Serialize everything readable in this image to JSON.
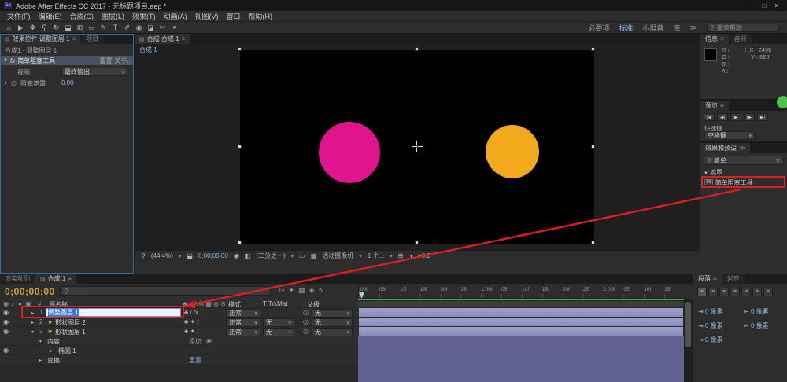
{
  "colors": {
    "annotation_red": "#dd1f1f",
    "magenta_circle": "#e0148c",
    "orange_circle": "#f2a91c",
    "layer_bar": "#9093c4",
    "expanded_region": "#616192",
    "cache_green": "#4aa845",
    "timecode_orange": "#cf9c3c",
    "value_blue": "#8cb4e4"
  },
  "title_bar": {
    "app_icon": "Ae",
    "title": "Adobe After Effects CC 2017 - 无标题项目.aep *",
    "minimize": "─",
    "maximize": "□",
    "close": "✕"
  },
  "menu_bar": [
    "文件(F)",
    "编辑(E)",
    "合成(C)",
    "图层(L)",
    "效果(T)",
    "动画(A)",
    "视图(V)",
    "窗口",
    "帮助(H)"
  ],
  "toolbar": {
    "tools": [
      "⌂",
      "▶",
      "✥",
      "⚲",
      "↻",
      "⬓",
      "⊞",
      "▭",
      "✎",
      "T",
      "✐",
      "◉",
      "◪",
      "✄",
      "⌖"
    ],
    "workspaces": [
      "必要项",
      "标准",
      "小屏幕",
      "库"
    ],
    "more_icon": "≫",
    "search_icon": "⚲",
    "search_placeholder": "搜索帮助"
  },
  "effect_controls": {
    "panel_icon": "▤",
    "tab_title": "效果控件 调整图层 1",
    "menu_icon": "≡",
    "project_tab": "项目",
    "comp_ref": "合成1 · 调整图层 1",
    "effect_expander": "▼",
    "fx_badge": "fx",
    "effect_name": "简单阻塞工具",
    "reset_label": "重置",
    "about_label": "关于..",
    "view_label": "视图",
    "view_value": "最终输出",
    "dropdown_arrow": "▾",
    "choke_expander": "▸",
    "stopwatch_icon": "◷",
    "choke_label": "阻塞遮罩",
    "choke_value": "0.00"
  },
  "viewer": {
    "panel_icon": "▤",
    "tab_title": "合成 合成 1",
    "menu_icon": "≡",
    "comp_chip": "合成 1",
    "zoom_icon": "⚲",
    "zoom_value": "(44.4%)",
    "dropdown_arrow": "▾",
    "safe_icon": "⬓",
    "timecode": "0;00;00;00",
    "snapshot_icon": "◉",
    "channel_icon": "◧",
    "resolution": "(二分之一)",
    "roi_icon": "▭",
    "grid_icon": "▦",
    "camera_value": "活动摄像机",
    "view_count": "1 个...",
    "pixel_icon": "⊞",
    "exposure_icon": "◑",
    "exposure_value": "+0.0"
  },
  "info_panel": {
    "tab": "信息",
    "menu_icon": "≡",
    "audio_tab": "音频",
    "r_label": "R :",
    "g_label": "G :",
    "b_label": "B :",
    "a_label": "A :",
    "crosshair": "⊹",
    "x_label": "X : 2495",
    "y_label": "Y : 553"
  },
  "preview_panel": {
    "tab": "预览",
    "menu_icon": "≡",
    "buttons": [
      "|◀",
      "◀|",
      "▶",
      "|▶",
      "▶|"
    ],
    "shortcut_label": "快捷键",
    "shortcut_value": "空格键",
    "dropdown_arrow": "▾"
  },
  "presets_panel": {
    "tab": "效果和预设",
    "more_icon": "≫",
    "search_icon": "⚲",
    "search_value": "简单",
    "clear_icon": "✕",
    "category_expander": "▼",
    "category": "遮罩",
    "item_badge": "16",
    "item_name": "简单阻塞工具"
  },
  "timeline": {
    "render_queue_tab": "渲染队列",
    "comp_icon": "▤",
    "comp_tab": "合成 1",
    "menu_icon": "≡",
    "timecode": "0;00;00;00",
    "search_icon": "⚲",
    "toolbar_icons": [
      "⊙",
      "✦",
      "▦",
      "◈",
      "∿"
    ],
    "eye_icon": "◉",
    "audio_icon": "♪",
    "solo_icon": "●",
    "lock_icon": "▣",
    "col_num": "#",
    "col_source": "源名称",
    "switch_icons": "♣ ✦ \\ fx ▦ ◎ ⊙",
    "col_mode": "模式",
    "col_trkmat": "T TrkMat",
    "col_parent": "父级",
    "expander_closed": "▸",
    "expander_open": "▾",
    "star_icon": "★",
    "pickwhip_icon": "◎",
    "mode_normal": "正常",
    "dropdown_arrow": "▾",
    "none_value": "无",
    "layers": [
      {
        "num": "1",
        "name": "调整图层 1",
        "switches": "♣ / fx"
      },
      {
        "num": "2",
        "name": "形状图层 2",
        "switches": "♣ ✦ /"
      },
      {
        "num": "3",
        "name": "形状图层 1",
        "switches": "♣ ✦ /"
      }
    ],
    "contents_label": "内容",
    "add_label": "添加:",
    "add_icon": "◉",
    "ellipse_label": "椭圆 1",
    "transform_label": "变换",
    "reset_label": "重置",
    "ruler": [
      ":00f",
      "05f",
      "10f",
      "15f",
      "20f",
      "25f",
      "1:00f",
      "05f",
      "10f",
      "15f",
      "20f",
      "25f",
      "2:00f",
      "05f",
      "10f",
      "15f"
    ]
  },
  "paragraph_panel": {
    "tab": "段落",
    "align_tab": "对齐",
    "menu_icon": "≡",
    "align_icons": [
      "≡",
      "≡",
      "≡",
      "≡",
      "≡",
      "≡",
      "≡"
    ],
    "fields": [
      {
        "icon": "⇥",
        "value": "0 像素"
      },
      {
        "icon": "⇤",
        "value": "0 像素"
      },
      {
        "icon": "⇥",
        "value": "0 像素"
      },
      {
        "icon": "⇤",
        "value": "0 像素"
      },
      {
        "icon": "⇥",
        "value": "0 像素"
      }
    ]
  }
}
